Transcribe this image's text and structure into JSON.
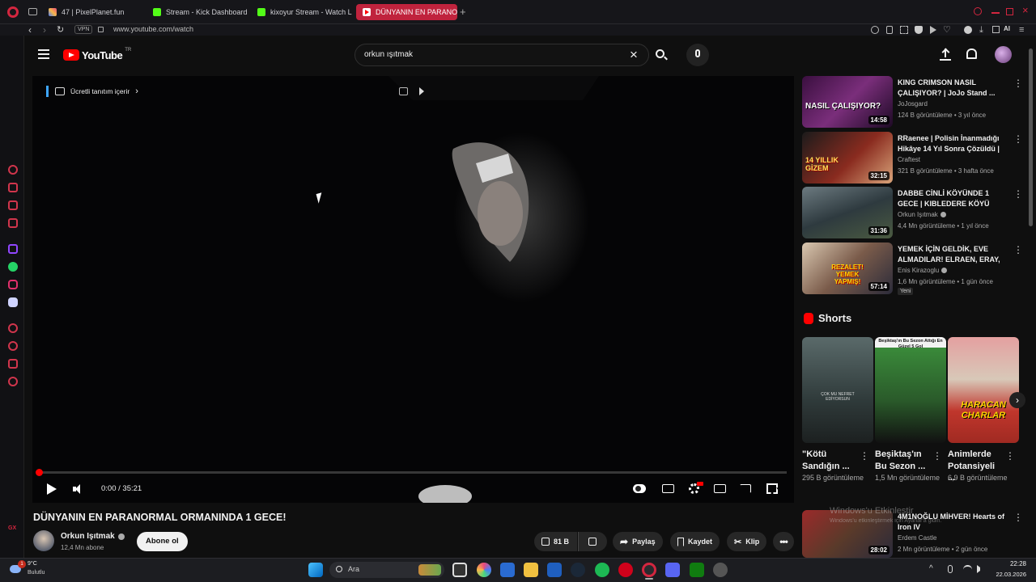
{
  "browser": {
    "tabs": [
      {
        "label": "47 | PixelPlanet.fun",
        "active": false
      },
      {
        "label": "Stream - Kick Dashboard",
        "active": false
      },
      {
        "label": "kixoyur Stream - Watch Li",
        "active": false
      },
      {
        "label": "DÜNYANIN EN PARANORM",
        "active": true
      }
    ],
    "url": "www.youtube.com/watch",
    "vpn_label": "VPN",
    "ai_label": "AI"
  },
  "youtube": {
    "logo_text": "YouTube",
    "region": "TR",
    "search_value": "orkun ışıtmak"
  },
  "player": {
    "promo_label": "Ücretli tanıtım içerir",
    "time_current": "0:00",
    "time_total": "35:21",
    "progress": 0
  },
  "video": {
    "title": "DÜNYANIN EN PARANORMAL ORMANINDA 1 GECE!",
    "channel": "Orkun Işıtmak",
    "subscribers": "12,4 Mn abone",
    "subscribe_label": "Abone ol",
    "likes": "81 B",
    "share_label": "Paylaş",
    "save_label": "Kaydet",
    "clip_label": "Klip"
  },
  "suggestions": [
    {
      "title": "KING CRIMSON NASIL ÇALIŞIYOR? | JoJo Stand ...",
      "channel": "JoJosgard",
      "meta": "124 B görüntüleme • 3 yıl önce",
      "duration": "14:58",
      "thumb_text": "NASIL ÇALIŞIYOR?",
      "verified": false
    },
    {
      "title": "RRaenee | Polisin İnanmadığı Hikâye 14 Yıl Sonra Çözüldü | ...",
      "channel": "Craftest",
      "meta": "321 B görüntüleme • 3 hafta önce",
      "duration": "32:15",
      "thumb_text": "14 YILLIK GİZEM",
      "verified": false
    },
    {
      "title": "DABBE CİNLİ KÖYÜNDE 1 GECE | KIBLEDERE KÖYÜ",
      "channel": "Orkun Işıtmak",
      "meta": "4,4 Mn görüntüleme • 1 yıl önce",
      "duration": "31:36",
      "thumb_text": "",
      "verified": true
    },
    {
      "title": "YEMEK İÇİN GELDİK, EVE ALMADILAR! ELRAEN, ERAY, ...",
      "channel": "Enis Kirazoglu",
      "meta": "1,6 Mn görüntüleme • 1 gün önce",
      "duration": "57:14",
      "thumb_text": "REZALET! YEMEK YAPMIŞ!",
      "verified": true,
      "badge": "Yeni"
    }
  ],
  "shorts": {
    "heading": "Shorts",
    "items": [
      {
        "title": "\"Kötü Sandığın ...",
        "views": "295 B görüntüleme",
        "caption": "ÇOK MU NEFRET EDİYORSUN"
      },
      {
        "title": "Beşiktaş'ın Bu Sezon ...",
        "views": "1,5 Mn görüntüleme",
        "caption": "Beşiktaş'ın Bu Sezon Attığı En Güzel 5 Gol"
      },
      {
        "title": "Animlerde Potansiyeli ...",
        "views": "6,9 B görüntüleme",
        "caption": "HARACAN CHARLAR"
      }
    ]
  },
  "next_suggestion": {
    "title": "4M1NOĞLU MİHVER! Hearts of Iron IV",
    "channel": "Erdem Castle",
    "meta": "2 Mn görüntüleme • 2 gün önce",
    "duration": "28:02"
  },
  "windows_watermark": {
    "line1": "Windows'u Etkinleştir",
    "line2": "Windows'u etkinleştirmek için Ayarlar'a gidin."
  },
  "taskbar": {
    "weather_temp": "9°C",
    "weather_desc": "Bulutlu",
    "search_label": "Ara",
    "time": "22:28",
    "date": "22.03.2026",
    "notification_count": "1"
  },
  "colors": {
    "youtube_red": "#ff0000",
    "opera_red": "#c0233d",
    "background": "#0f0f0f"
  }
}
